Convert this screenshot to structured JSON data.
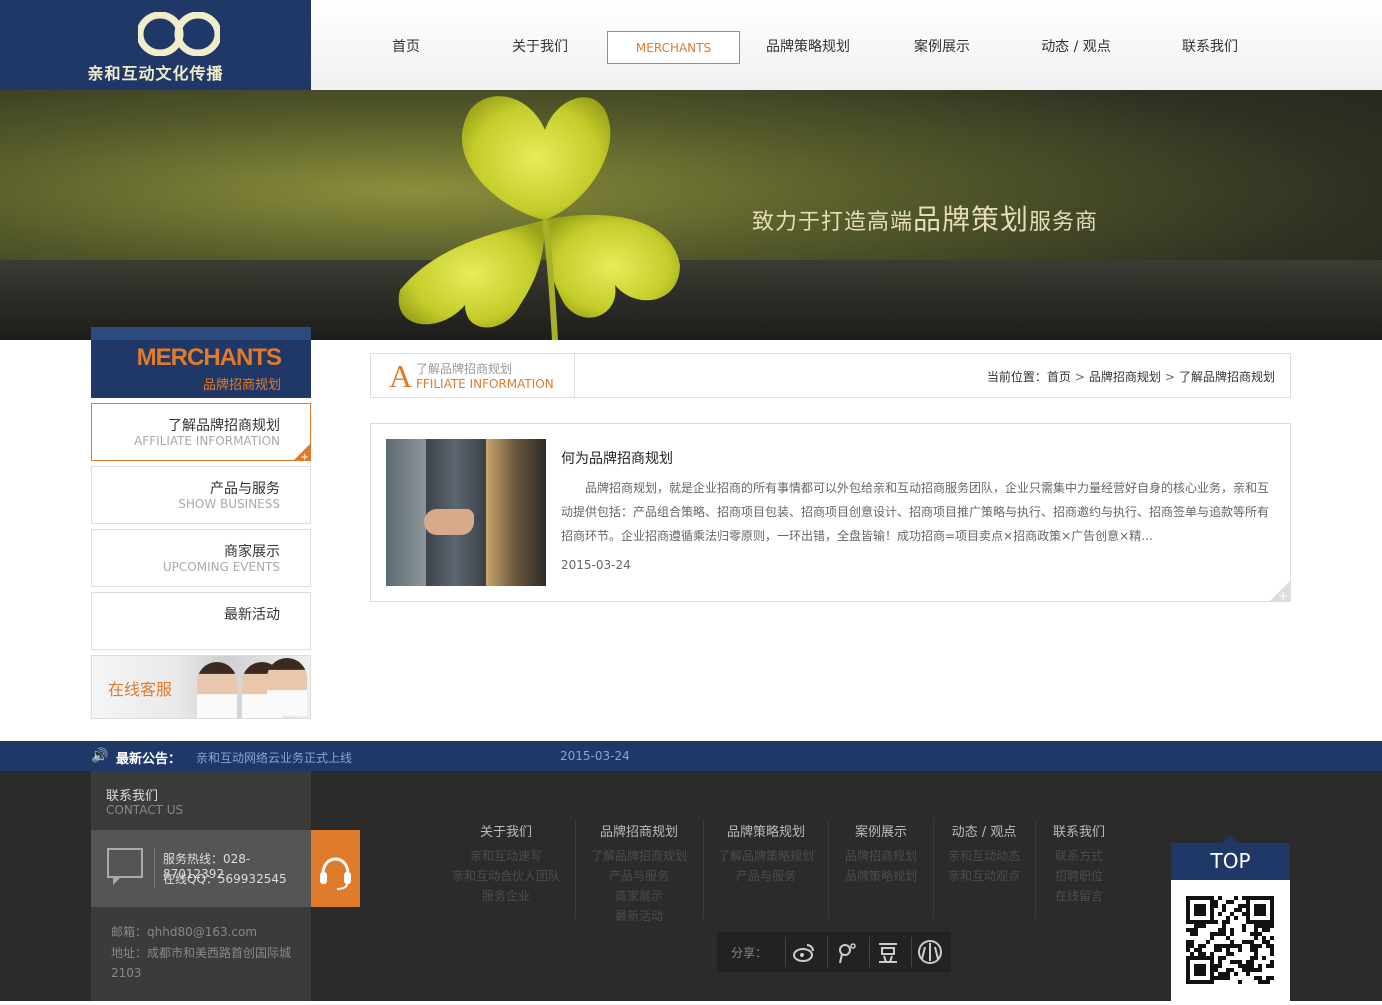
{
  "brand": {
    "name": "亲和互动文化传播",
    "color_primary": "#1f3867",
    "color_accent": "#e07b2c"
  },
  "nav": {
    "items": [
      {
        "label": "首页"
      },
      {
        "label": "关于我们"
      },
      {
        "label": "MERCHANTS",
        "active": true
      },
      {
        "label": "品牌策略规划"
      },
      {
        "label": "案例展示"
      },
      {
        "label": "动态 / 观点"
      },
      {
        "label": "联系我们"
      }
    ]
  },
  "banner": {
    "slogan_prefix": "致力于打造高端",
    "slogan_emph": "品牌策划",
    "slogan_suffix": "服务商"
  },
  "sidebar": {
    "title_en": "MERCHANTS",
    "title_cn": "品牌招商规划",
    "items": [
      {
        "cn": "了解品牌招商规划",
        "en": "AFFILIATE INFORMATION",
        "active": true
      },
      {
        "cn": "产品与服务",
        "en": "SHOW BUSINESS"
      },
      {
        "cn": "商家展示",
        "en": "UPCOMING EVENTS"
      },
      {
        "cn": "最新活动",
        "en": ""
      }
    ],
    "service_label": "在线客服"
  },
  "section": {
    "letter": "A",
    "title_cn": "了解品牌招商规划",
    "title_en": "FFILIATE INFORMATION",
    "breadcrumb": {
      "prefix": "当前位置：",
      "home": "首页",
      "sep": ">",
      "level1": "品牌招商规划",
      "level2": "了解品牌招商规划"
    }
  },
  "article": {
    "title": "何为品牌招商规划",
    "body": "品牌招商规划，就是企业招商的所有事情都可以外包给亲和互动招商服务团队，企业只需集中力量经营好自身的核心业务，亲和互动提供包括：产品组合策略、招商项目包装、招商项目创意设计、招商项目推广策略与执行、招商邀约与执行、招商签单与追款等所有招商环节。企业招商遵循乘法归零原则，一环出错，全盘皆输！成功招商=项目卖点×招商政策×广告创意×精...",
    "date": "2015-03-24"
  },
  "notice": {
    "label": "最新公告：",
    "message": "亲和互动网络云业务正式上线",
    "date": "2015-03-24"
  },
  "contact": {
    "title_cn": "联系我们",
    "title_en": "CONTACT US",
    "hotline": "服务热线：028-87012392",
    "qq": "在线QQ：569932545",
    "email": "邮箱：qhhd80@163.com",
    "address": "地址：成都市和美西路首创国际城2103"
  },
  "footer_links": [
    {
      "heading": "关于我们",
      "links": [
        "亲和互动速写",
        "亲和互动合伙人团队",
        "服务企业"
      ]
    },
    {
      "heading": "品牌招商规划",
      "links": [
        "了解品牌招商规划",
        "产品与服务",
        "商家展示",
        "最新活动"
      ]
    },
    {
      "heading": "品牌策略规划",
      "links": [
        "了解品牌策略规划",
        "产品与服务"
      ]
    },
    {
      "heading": "案例展示",
      "links": [
        "品牌招商规划",
        "品牌策略规划"
      ]
    },
    {
      "heading": "动态 / 观点",
      "links": [
        "亲和互动动态",
        "亲和互动观点"
      ]
    },
    {
      "heading": "联系我们",
      "links": [
        "联系方式",
        "招聘职位",
        "在线留言"
      ]
    }
  ],
  "share": {
    "label": "分享：",
    "icons": [
      "weibo-icon",
      "tencent-weibo-icon",
      "douban-icon",
      "renren-icon"
    ]
  },
  "top_button": {
    "label": "TOP"
  }
}
